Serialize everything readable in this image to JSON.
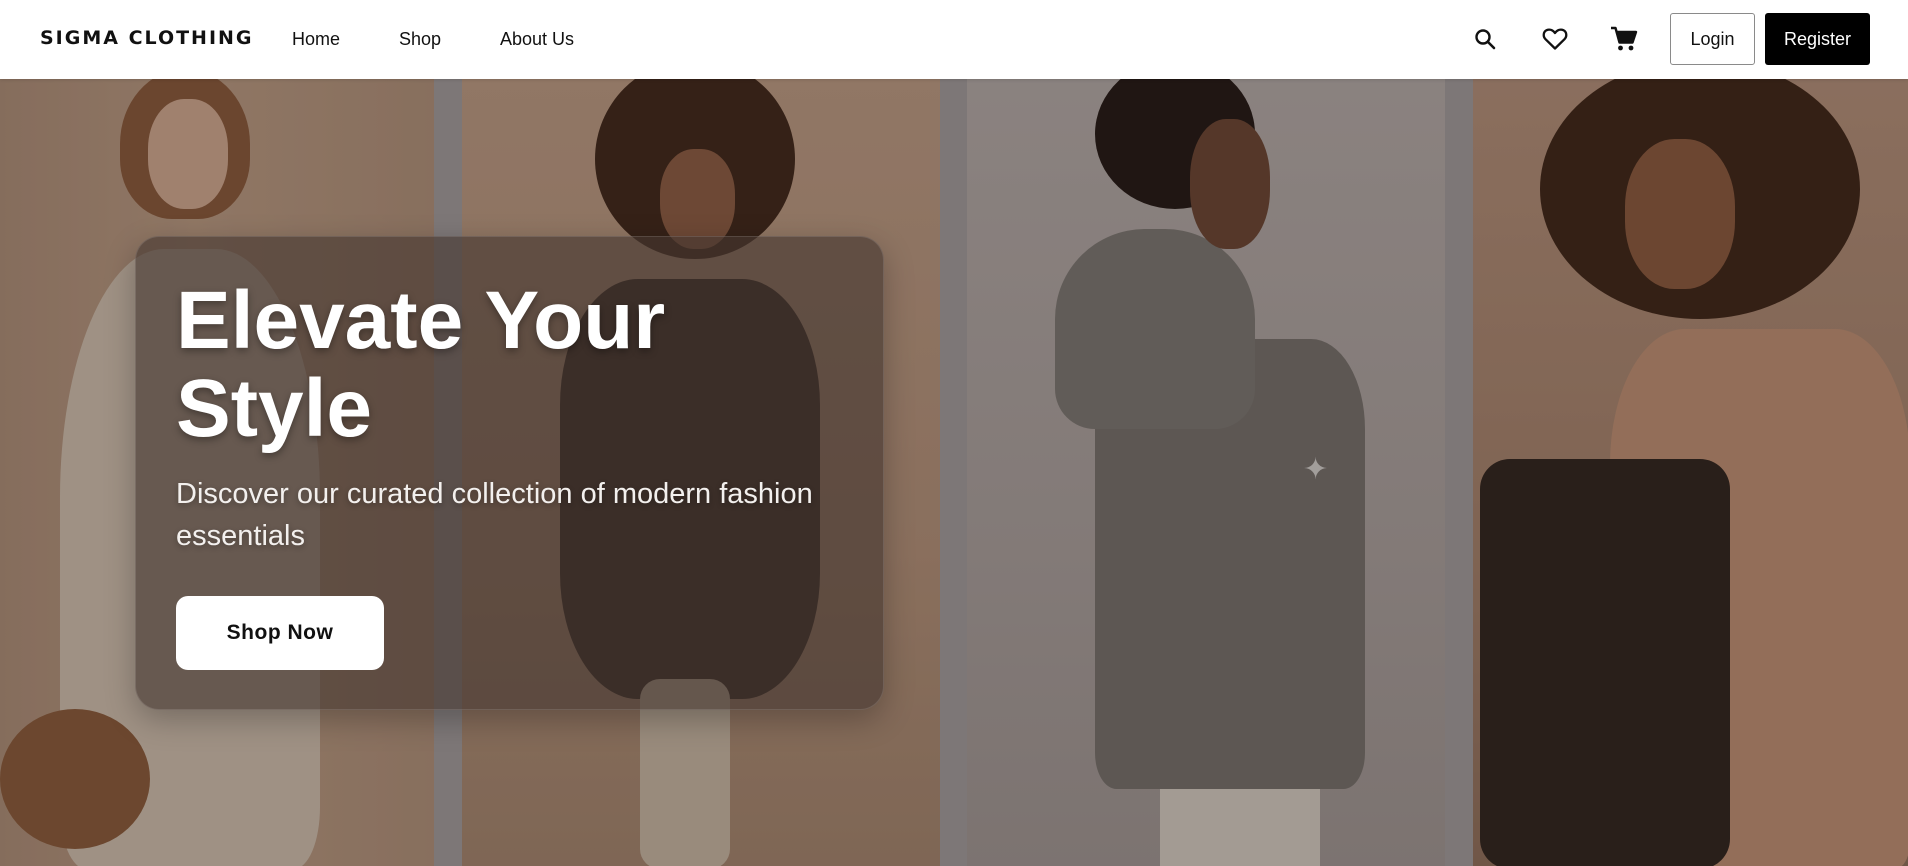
{
  "header": {
    "brand": "SIGMA CLOTHING",
    "nav": [
      {
        "label": "Home"
      },
      {
        "label": "Shop"
      },
      {
        "label": "About Us"
      }
    ],
    "icons": [
      "search-icon",
      "heart-icon",
      "cart-icon"
    ],
    "login_label": "Login",
    "register_label": "Register"
  },
  "hero": {
    "title": "Elevate Your Style",
    "subtitle": "Discover our curated collection of modern fashion essentials",
    "cta_label": "Shop Now"
  },
  "colors": {
    "primary": "#000000",
    "background": "#ffffff",
    "card_overlay": "#463730"
  }
}
